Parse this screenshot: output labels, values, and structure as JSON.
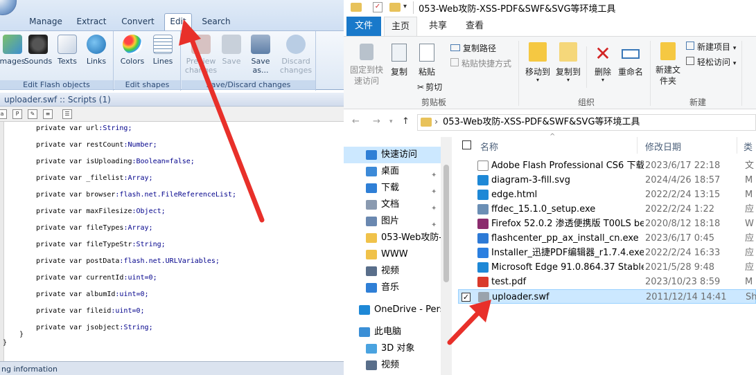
{
  "left_app": {
    "ribbon_tabs": [
      "Manage",
      "Extract",
      "Convert",
      "Edit",
      "Search"
    ],
    "active_tab": "Edit",
    "groups": {
      "edit_flash_objects": {
        "caption": "Edit Flash objects",
        "buttons": [
          "mages",
          "Sounds",
          "Texts",
          "Links"
        ]
      },
      "edit_shapes": {
        "caption": "Edit shapes",
        "buttons": [
          "Colors",
          "Lines"
        ]
      },
      "save_discard": {
        "caption": "Save/Discard changes",
        "buttons": [
          "Preview changes",
          "Save",
          "Save as...",
          "Discard changes"
        ]
      }
    },
    "doc_title": "uploader.swf :: Scripts (1)",
    "code_lines": [
      {
        "kw": "private var ",
        "name": "url",
        "type": ":String;"
      },
      {
        "kw": "private var ",
        "name": "restCount",
        "type": ":Number;"
      },
      {
        "kw": "private var ",
        "name": "isUploading",
        "type": ":Boolean=false;"
      },
      {
        "kw": "private var ",
        "name": "_filelist",
        "type": ":Array;"
      },
      {
        "kw": "private var ",
        "name": "browser",
        "type": ":flash.net.FileReferenceList;"
      },
      {
        "kw": "private var ",
        "name": "maxFilesize",
        "type": ":Object;"
      },
      {
        "kw": "private var ",
        "name": "fileTypes",
        "type": ":Array;"
      },
      {
        "kw": "private var ",
        "name": "fileTypeStr",
        "type": ":String;"
      },
      {
        "kw": "private var ",
        "name": "postData",
        "type": ":flash.net.URLVariables;"
      },
      {
        "kw": "private var ",
        "name": "currentId",
        "type": ":uint=0;"
      },
      {
        "kw": "private var ",
        "name": "albumId",
        "type": ":uint=0;"
      },
      {
        "kw": "private var ",
        "name": "fileid",
        "type": ":uint=0;"
      },
      {
        "kw": "private var ",
        "name": "jsobject",
        "type": ":String;"
      }
    ],
    "closing_braces": [
      "}",
      "}"
    ],
    "status_text": "ng information"
  },
  "explorer": {
    "window_title": "053-Web攻防-XSS-PDF&SWF&SVG等环境工具",
    "ribbon_tabs": [
      "文件",
      "主页",
      "共享",
      "查看"
    ],
    "active_tab": "主页",
    "clipboard": {
      "pin": "固定到快速访问",
      "copy": "复制",
      "paste": "粘贴",
      "copy_path": "复制路径",
      "paste_shortcut": "粘贴快捷方式",
      "cut": "剪切",
      "caption": "剪贴板"
    },
    "organize": {
      "move_to": "移动到",
      "copy_to": "复制到",
      "delete": "删除",
      "rename": "重命名",
      "caption": "组织"
    },
    "new": {
      "new_folder": "新建文件夹",
      "new_item": "新建项目",
      "easy_access": "轻松访问",
      "caption": "新建"
    },
    "address": "053-Web攻防-XSS-PDF&SWF&SVG等环境工具",
    "columns": {
      "name": "名称",
      "date": "修改日期",
      "type": "类"
    },
    "nav_items": [
      {
        "label": "快速访问",
        "icon": "star-icon",
        "pinned": false
      },
      {
        "label": "桌面",
        "icon": "desktop-icon",
        "pinned": true
      },
      {
        "label": "下载",
        "icon": "download-icon",
        "pinned": true
      },
      {
        "label": "文档",
        "icon": "document-icon",
        "pinned": true
      },
      {
        "label": "图片",
        "icon": "pictures-icon",
        "pinned": true
      },
      {
        "label": "053-Web攻防-XSS-P",
        "icon": "folder-icon",
        "pinned": false
      },
      {
        "label": "WWW",
        "icon": "folder-icon",
        "pinned": false
      },
      {
        "label": "视频",
        "icon": "video-icon",
        "pinned": false
      },
      {
        "label": "音乐",
        "icon": "music-icon",
        "pinned": false
      },
      {
        "label": "OneDrive - Perso",
        "icon": "cloud-icon",
        "pinned": false
      },
      {
        "label": "此电脑",
        "icon": "computer-icon",
        "pinned": false
      },
      {
        "label": "3D 对象",
        "icon": "cube-icon",
        "pinned": false
      },
      {
        "label": "视频",
        "icon": "video-icon",
        "pinned": false
      }
    ],
    "files": [
      {
        "name": "Adobe Flash Professional CS6 下载...",
        "date": "2023/6/17 22:18",
        "type": "文",
        "icon": "text-file-icon",
        "color": "#ffffff"
      },
      {
        "name": "diagram-3-fill.svg",
        "date": "2024/4/26 18:57",
        "type": "M",
        "icon": "edge-icon",
        "color": "#1e88d6"
      },
      {
        "name": "edge.html",
        "date": "2022/2/24 13:15",
        "type": "M",
        "icon": "edge-icon",
        "color": "#1e88d6"
      },
      {
        "name": "ffdec_15.1.0_setup.exe",
        "date": "2022/2/24 1:22",
        "type": "应",
        "icon": "installer-icon",
        "color": "#6b8fb5"
      },
      {
        "name": "Firefox 52.0.2 渗透便携版 T00LS bet...",
        "date": "2020/8/12 18:18",
        "type": "W",
        "icon": "winrar-icon",
        "color": "#8b2c6e"
      },
      {
        "name": "flashcenter_pp_ax_install_cn.exe",
        "date": "2023/6/17 0:45",
        "type": "应",
        "icon": "flash-icon",
        "color": "#2d7ad6"
      },
      {
        "name": "Installer_迅捷PDF编辑器_r1.7.4.exe",
        "date": "2022/2/24 16:33",
        "type": "应",
        "icon": "pdf-editor-icon",
        "color": "#2b7fe0"
      },
      {
        "name": "Microsoft Edge 91.0.864.37 Stable...",
        "date": "2021/5/28 9:48",
        "type": "应",
        "icon": "edge-icon",
        "color": "#1e88d6"
      },
      {
        "name": "test.pdf",
        "date": "2023/10/23 8:59",
        "type": "M",
        "icon": "pdf-icon",
        "color": "#d93a2b"
      },
      {
        "name": "uploader.swf",
        "date": "2011/12/14 14:41",
        "type": "Sh",
        "icon": "swf-icon",
        "color": "#9aa3ad"
      }
    ],
    "selected_file": "uploader.swf"
  },
  "colors": {
    "annotation_arrow": "#e8302a",
    "file_tab": "#1979ca",
    "selection": "#cce8ff"
  }
}
